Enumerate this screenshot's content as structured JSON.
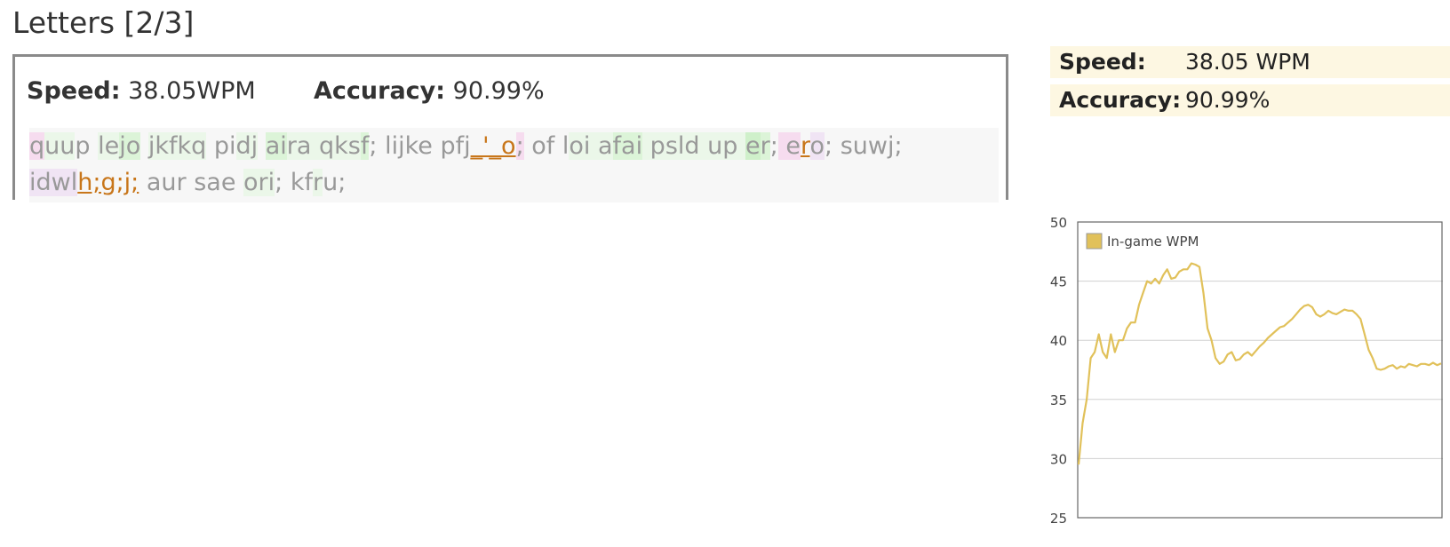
{
  "lesson": {
    "title": "Letters [2/3]"
  },
  "stats_bar": {
    "speed_label": "Speed:",
    "speed_value": "38.05WPM",
    "accuracy_label": "Accuracy:",
    "accuracy_value": "90.99%"
  },
  "typed_text": {
    "line1": [
      {
        "t": "q",
        "c": "err"
      },
      {
        "t": "uu",
        "c": "ok1"
      },
      {
        "t": "p ",
        "c": ""
      },
      {
        "t": "le",
        "c": "ok1"
      },
      {
        "t": "jo",
        "c": "ok2"
      },
      {
        "t": " ",
        "c": ""
      },
      {
        "t": "jkfkq",
        "c": "ok1"
      },
      {
        "t": " pi",
        "c": ""
      },
      {
        "t": "dj",
        "c": "ok1"
      },
      {
        "t": " ",
        "c": ""
      },
      {
        "t": "ai",
        "c": "ok2"
      },
      {
        "t": "ra",
        "c": "ok1"
      },
      {
        "t": " qks",
        "c": "ok1"
      },
      {
        "t": "f",
        "c": "ok2"
      },
      {
        "t": "; lijke pfj",
        "c": ""
      },
      {
        "t": "_'_o",
        "c": "typo"
      },
      {
        "t": ";",
        "c": "err"
      },
      {
        "t": " of l",
        "c": ""
      },
      {
        "t": "oi a",
        "c": "ok1"
      },
      {
        "t": "fai",
        "c": "ok2"
      },
      {
        "t": " psld up ",
        "c": "ok1"
      },
      {
        "t": "e",
        "c": "ok3"
      },
      {
        "t": "r",
        "c": "ok2"
      },
      {
        "t": ";",
        "c": ""
      },
      {
        "t": " e",
        "c": "err"
      },
      {
        "t": "r",
        "c": "typo"
      },
      {
        "t": "o",
        "c": "er2"
      },
      {
        "t": "; suwj;",
        "c": ""
      }
    ],
    "line2": [
      {
        "t": "idwl",
        "c": "er2"
      },
      {
        "t": "h;g;j;",
        "c": "typo"
      },
      {
        "t": " aur sae ",
        "c": ""
      },
      {
        "t": "ori",
        "c": "ok1"
      },
      {
        "t": "; kf",
        "c": ""
      },
      {
        "t": "r",
        "c": "ok1"
      },
      {
        "t": "u;",
        "c": ""
      }
    ]
  },
  "summary": {
    "speed_label": "Speed:",
    "speed_value": "38.05 WPM",
    "accuracy_label": "Accuracy:",
    "accuracy_value": "90.99%"
  },
  "chart_data": {
    "type": "line",
    "ylim": [
      25,
      50
    ],
    "yticks": [
      "50",
      "45",
      "40",
      "35",
      "30",
      "25"
    ],
    "legend": "top-left",
    "grid": true,
    "series": [
      {
        "name": "In-game WPM",
        "color": "#e1c15a",
        "values": [
          29.5,
          33,
          35,
          38.5,
          39,
          40.5,
          39,
          38.5,
          40.5,
          39,
          40,
          40,
          41,
          41.5,
          41.5,
          43,
          44,
          45,
          44.8,
          45.2,
          44.8,
          45.5,
          46,
          45.2,
          45.3,
          45.8,
          46,
          46,
          46.5,
          46.4,
          46.2,
          44,
          41,
          40,
          38.5,
          38,
          38.2,
          38.8,
          39,
          38.3,
          38.4,
          38.8,
          39,
          38.7,
          39.1,
          39.5,
          39.8,
          40.2,
          40.5,
          40.8,
          41.1,
          41.2,
          41.5,
          41.8,
          42.2,
          42.6,
          42.9,
          43,
          42.8,
          42.2,
          42,
          42.2,
          42.5,
          42.3,
          42.2,
          42.4,
          42.6,
          42.5,
          42.5,
          42.2,
          41.8,
          40.5,
          39.2,
          38.5,
          37.6,
          37.5,
          37.6,
          37.8,
          37.9,
          37.6,
          37.8,
          37.7,
          38,
          37.9,
          37.8,
          38,
          38,
          37.9,
          38.1,
          37.9,
          38.05
        ]
      }
    ]
  }
}
